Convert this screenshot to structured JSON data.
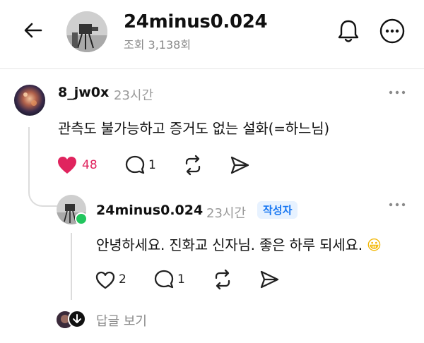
{
  "header": {
    "title": "24minus0.024",
    "views": "조회 3,138회"
  },
  "comment": {
    "username": "8_jw0x",
    "time": "23시간",
    "text": "관측도 불가능하고 증거도 없는 설화(=하느님)",
    "likes": "48",
    "replies": "1"
  },
  "reply": {
    "username": "24minus0.024",
    "time": "23시간",
    "badge": "작성자",
    "text": "안녕하세요. 진화교 신자님. 좋은 하루 되세요. ",
    "emoji": "😀",
    "likes": "2",
    "replies": "1"
  },
  "footer": {
    "view_replies": "답글 보기"
  },
  "colors": {
    "liked": "#e0245e",
    "badge_bg": "#e7f2ff",
    "badge_text": "#1877f2",
    "online": "#22c55e"
  }
}
